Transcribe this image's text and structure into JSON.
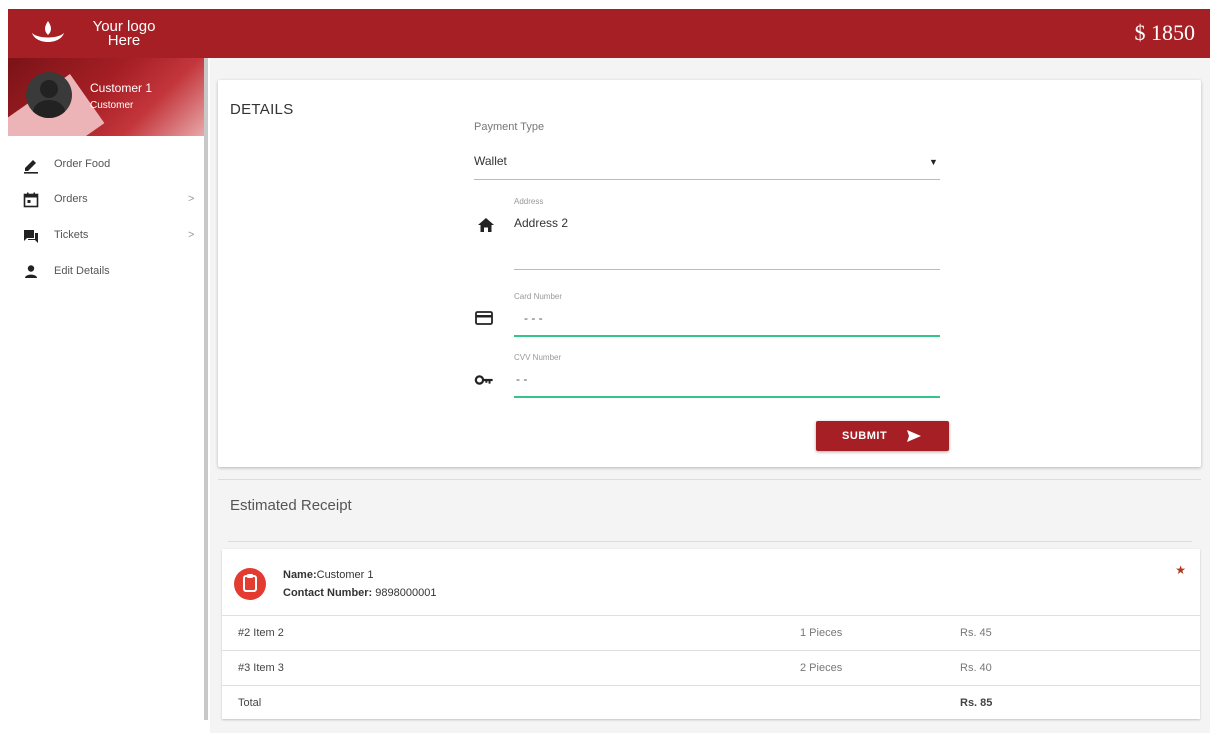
{
  "header": {
    "logo_text": "Your logo Here",
    "logo_line1": "Your logo",
    "logo_line2": "Here",
    "balance": "$ 1850",
    "brand_color": "#a51f24"
  },
  "profile": {
    "name": "Customer 1",
    "role": "Customer"
  },
  "sidebar": {
    "items": [
      {
        "label": "Order Food",
        "icon": "pencil-icon",
        "has_submenu": false
      },
      {
        "label": "Orders",
        "icon": "calendar-icon",
        "has_submenu": true
      },
      {
        "label": "Tickets",
        "icon": "chat-icon",
        "has_submenu": true
      },
      {
        "label": "Edit Details",
        "icon": "person-icon",
        "has_submenu": false
      }
    ],
    "chevron": ">"
  },
  "details": {
    "title": "DETAILS",
    "payment_type": {
      "label": "Payment Type",
      "value": "Wallet"
    },
    "address": {
      "label": "Address",
      "value": "Address 2",
      "icon": "home-icon"
    },
    "card_number": {
      "label": "Card Number",
      "value": "-  -  -",
      "icon": "credit-card-icon"
    },
    "cvv": {
      "label": "CVV Number",
      "value": "- -",
      "icon": "key-icon"
    },
    "submit_label": "SUBMIT",
    "accent_color": "#35c48a"
  },
  "receipt": {
    "title": "Estimated Receipt",
    "name_label": "Name:",
    "name_value": "Customer 1",
    "contact_label": "Contact Number:",
    "contact_value": " 9898000001",
    "items": [
      {
        "item": "#2 Item 2",
        "qty": "1 Pieces",
        "price": "Rs. 45"
      },
      {
        "item": "#3 Item 3",
        "qty": "2 Pieces",
        "price": "Rs. 40"
      }
    ],
    "total_label": "Total",
    "total_value": "Rs. 85"
  }
}
